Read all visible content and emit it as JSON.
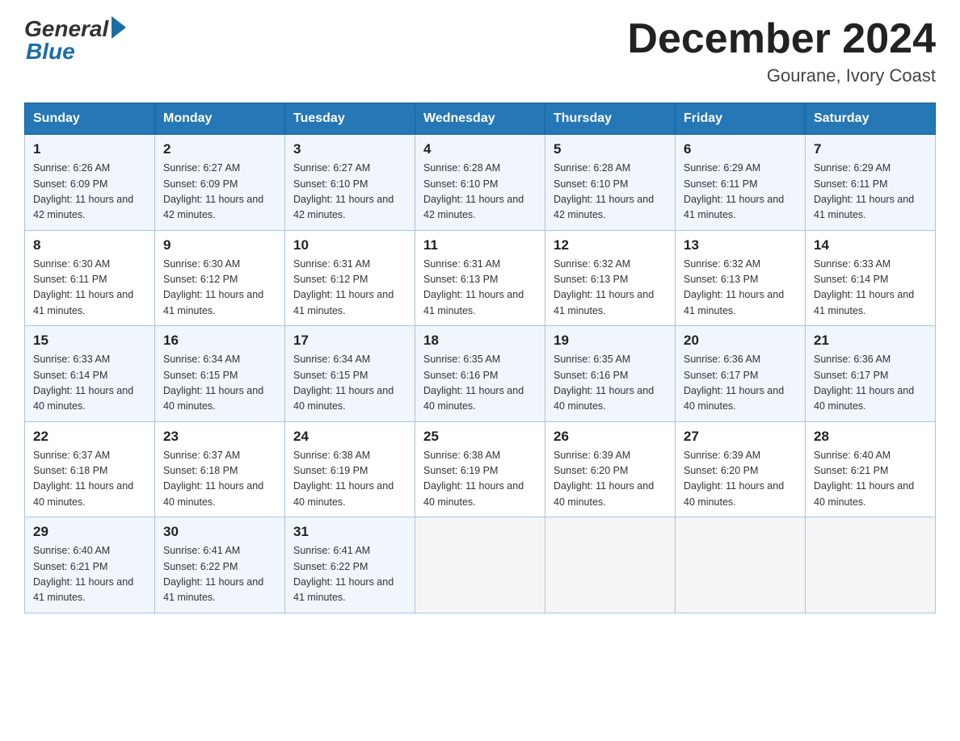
{
  "logo": {
    "general": "General",
    "blue": "Blue"
  },
  "title": "December 2024",
  "location": "Gourane, Ivory Coast",
  "days_of_week": [
    "Sunday",
    "Monday",
    "Tuesday",
    "Wednesday",
    "Thursday",
    "Friday",
    "Saturday"
  ],
  "weeks": [
    [
      {
        "day": "1",
        "sunrise": "Sunrise: 6:26 AM",
        "sunset": "Sunset: 6:09 PM",
        "daylight": "Daylight: 11 hours and 42 minutes."
      },
      {
        "day": "2",
        "sunrise": "Sunrise: 6:27 AM",
        "sunset": "Sunset: 6:09 PM",
        "daylight": "Daylight: 11 hours and 42 minutes."
      },
      {
        "day": "3",
        "sunrise": "Sunrise: 6:27 AM",
        "sunset": "Sunset: 6:10 PM",
        "daylight": "Daylight: 11 hours and 42 minutes."
      },
      {
        "day": "4",
        "sunrise": "Sunrise: 6:28 AM",
        "sunset": "Sunset: 6:10 PM",
        "daylight": "Daylight: 11 hours and 42 minutes."
      },
      {
        "day": "5",
        "sunrise": "Sunrise: 6:28 AM",
        "sunset": "Sunset: 6:10 PM",
        "daylight": "Daylight: 11 hours and 42 minutes."
      },
      {
        "day": "6",
        "sunrise": "Sunrise: 6:29 AM",
        "sunset": "Sunset: 6:11 PM",
        "daylight": "Daylight: 11 hours and 41 minutes."
      },
      {
        "day": "7",
        "sunrise": "Sunrise: 6:29 AM",
        "sunset": "Sunset: 6:11 PM",
        "daylight": "Daylight: 11 hours and 41 minutes."
      }
    ],
    [
      {
        "day": "8",
        "sunrise": "Sunrise: 6:30 AM",
        "sunset": "Sunset: 6:11 PM",
        "daylight": "Daylight: 11 hours and 41 minutes."
      },
      {
        "day": "9",
        "sunrise": "Sunrise: 6:30 AM",
        "sunset": "Sunset: 6:12 PM",
        "daylight": "Daylight: 11 hours and 41 minutes."
      },
      {
        "day": "10",
        "sunrise": "Sunrise: 6:31 AM",
        "sunset": "Sunset: 6:12 PM",
        "daylight": "Daylight: 11 hours and 41 minutes."
      },
      {
        "day": "11",
        "sunrise": "Sunrise: 6:31 AM",
        "sunset": "Sunset: 6:13 PM",
        "daylight": "Daylight: 11 hours and 41 minutes."
      },
      {
        "day": "12",
        "sunrise": "Sunrise: 6:32 AM",
        "sunset": "Sunset: 6:13 PM",
        "daylight": "Daylight: 11 hours and 41 minutes."
      },
      {
        "day": "13",
        "sunrise": "Sunrise: 6:32 AM",
        "sunset": "Sunset: 6:13 PM",
        "daylight": "Daylight: 11 hours and 41 minutes."
      },
      {
        "day": "14",
        "sunrise": "Sunrise: 6:33 AM",
        "sunset": "Sunset: 6:14 PM",
        "daylight": "Daylight: 11 hours and 41 minutes."
      }
    ],
    [
      {
        "day": "15",
        "sunrise": "Sunrise: 6:33 AM",
        "sunset": "Sunset: 6:14 PM",
        "daylight": "Daylight: 11 hours and 40 minutes."
      },
      {
        "day": "16",
        "sunrise": "Sunrise: 6:34 AM",
        "sunset": "Sunset: 6:15 PM",
        "daylight": "Daylight: 11 hours and 40 minutes."
      },
      {
        "day": "17",
        "sunrise": "Sunrise: 6:34 AM",
        "sunset": "Sunset: 6:15 PM",
        "daylight": "Daylight: 11 hours and 40 minutes."
      },
      {
        "day": "18",
        "sunrise": "Sunrise: 6:35 AM",
        "sunset": "Sunset: 6:16 PM",
        "daylight": "Daylight: 11 hours and 40 minutes."
      },
      {
        "day": "19",
        "sunrise": "Sunrise: 6:35 AM",
        "sunset": "Sunset: 6:16 PM",
        "daylight": "Daylight: 11 hours and 40 minutes."
      },
      {
        "day": "20",
        "sunrise": "Sunrise: 6:36 AM",
        "sunset": "Sunset: 6:17 PM",
        "daylight": "Daylight: 11 hours and 40 minutes."
      },
      {
        "day": "21",
        "sunrise": "Sunrise: 6:36 AM",
        "sunset": "Sunset: 6:17 PM",
        "daylight": "Daylight: 11 hours and 40 minutes."
      }
    ],
    [
      {
        "day": "22",
        "sunrise": "Sunrise: 6:37 AM",
        "sunset": "Sunset: 6:18 PM",
        "daylight": "Daylight: 11 hours and 40 minutes."
      },
      {
        "day": "23",
        "sunrise": "Sunrise: 6:37 AM",
        "sunset": "Sunset: 6:18 PM",
        "daylight": "Daylight: 11 hours and 40 minutes."
      },
      {
        "day": "24",
        "sunrise": "Sunrise: 6:38 AM",
        "sunset": "Sunset: 6:19 PM",
        "daylight": "Daylight: 11 hours and 40 minutes."
      },
      {
        "day": "25",
        "sunrise": "Sunrise: 6:38 AM",
        "sunset": "Sunset: 6:19 PM",
        "daylight": "Daylight: 11 hours and 40 minutes."
      },
      {
        "day": "26",
        "sunrise": "Sunrise: 6:39 AM",
        "sunset": "Sunset: 6:20 PM",
        "daylight": "Daylight: 11 hours and 40 minutes."
      },
      {
        "day": "27",
        "sunrise": "Sunrise: 6:39 AM",
        "sunset": "Sunset: 6:20 PM",
        "daylight": "Daylight: 11 hours and 40 minutes."
      },
      {
        "day": "28",
        "sunrise": "Sunrise: 6:40 AM",
        "sunset": "Sunset: 6:21 PM",
        "daylight": "Daylight: 11 hours and 40 minutes."
      }
    ],
    [
      {
        "day": "29",
        "sunrise": "Sunrise: 6:40 AM",
        "sunset": "Sunset: 6:21 PM",
        "daylight": "Daylight: 11 hours and 41 minutes."
      },
      {
        "day": "30",
        "sunrise": "Sunrise: 6:41 AM",
        "sunset": "Sunset: 6:22 PM",
        "daylight": "Daylight: 11 hours and 41 minutes."
      },
      {
        "day": "31",
        "sunrise": "Sunrise: 6:41 AM",
        "sunset": "Sunset: 6:22 PM",
        "daylight": "Daylight: 11 hours and 41 minutes."
      },
      null,
      null,
      null,
      null
    ]
  ]
}
